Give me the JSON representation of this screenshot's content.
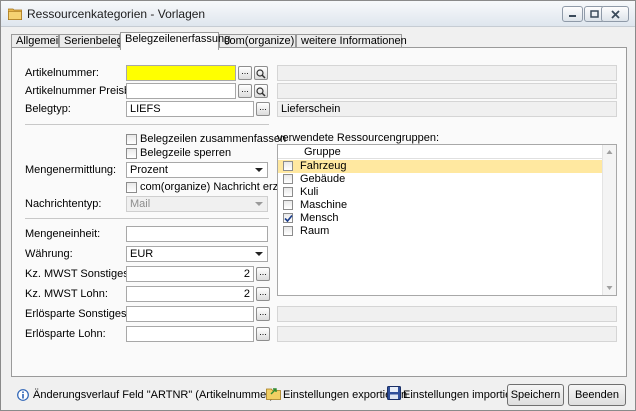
{
  "window": {
    "title": "Ressourcenkategorien - Vorlagen"
  },
  "tabs": [
    {
      "label": "Allgemein"
    },
    {
      "label": "Serienbelege"
    },
    {
      "label": "Belegzeilenerfassung"
    },
    {
      "label": "com(organize)"
    },
    {
      "label": "weitere Informationen"
    }
  ],
  "form": {
    "artikelnummer_label": "Artikelnummer:",
    "artikelnummer_value": "",
    "artikelnummer_preisbasis_label": "Artikelnummer Preisbasis:",
    "artikelnummer_preisbasis_value": "",
    "belegtyp_label": "Belegtyp:",
    "belegtyp_value": "LIEFS",
    "belegtyp_desc": "Lieferschein",
    "chk_zusammenfassen": "Belegzeilen zusammenfassen",
    "chk_sperren": "Belegzeile sperren",
    "mengenermittlung_label": "Mengenermittlung:",
    "mengenermittlung_value": "Prozent",
    "chk_nachricht": "com(organize) Nachricht erzeugen",
    "nachrichtentyp_label": "Nachrichtentyp:",
    "nachrichtentyp_value": "Mail",
    "mengeneinheit_label": "Mengeneinheit:",
    "mengeneinheit_value": "",
    "waehrung_label": "Währung:",
    "waehrung_value": "EUR",
    "kz_mwst_sonstiges_label": "Kz. MWST Sonstiges:",
    "kz_mwst_sonstiges_value": "2",
    "kz_mwst_lohn_label": "Kz. MWST Lohn:",
    "kz_mwst_lohn_value": "2",
    "erloesparte_sonstiges_label": "Erlösparte Sonstiges:",
    "erloesparte_sonstiges_value": "",
    "erloesparte_lohn_label": "Erlösparte Lohn:",
    "erloesparte_lohn_value": ""
  },
  "ressourcengruppen": {
    "title": "verwendete Ressourcengruppen:",
    "column": "Gruppe",
    "rows": [
      {
        "label": "Fahrzeug",
        "checked": false,
        "selected": true
      },
      {
        "label": "Gebäude",
        "checked": false,
        "selected": false
      },
      {
        "label": "Kuli",
        "checked": false,
        "selected": false
      },
      {
        "label": "Maschine",
        "checked": false,
        "selected": false
      },
      {
        "label": "Mensch",
        "checked": true,
        "selected": false
      },
      {
        "label": "Raum",
        "checked": false,
        "selected": false
      }
    ]
  },
  "footer": {
    "info_text": "Änderungsverlauf Feld \"ARTNR\" (Artikelnummer)",
    "export_label": "Einstellungen exportieren",
    "import_label": "Einstellungen importieren",
    "save_label": "Speichern",
    "close_label": "Beenden"
  },
  "buttons": {
    "ellipsis": "...",
    "chk_mark": "✓"
  }
}
